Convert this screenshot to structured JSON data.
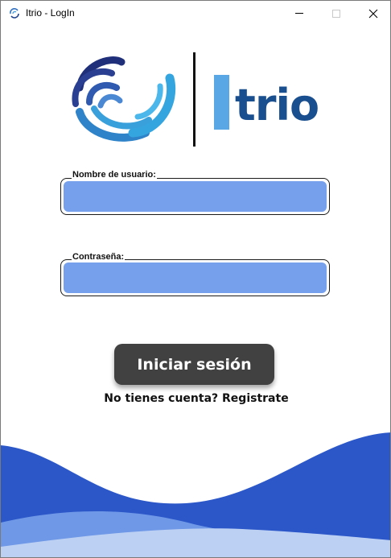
{
  "window": {
    "title": "Itrio - LogIn",
    "controls": [
      "minimize",
      "maximize",
      "close"
    ]
  },
  "logo": {
    "brand_text": "trio",
    "icon": "swirl-logo-icon"
  },
  "form": {
    "username": {
      "label": "Nombre de usuario:",
      "value": "",
      "placeholder": ""
    },
    "password": {
      "label": "Contraseña:",
      "value": "",
      "placeholder": ""
    },
    "login_label": "Iniciar sesión",
    "register_label": "No tienes cuenta? Registrate"
  },
  "colors": {
    "input_fill": "#76a0ec",
    "button_bg": "#414141",
    "brand_dark": "#1a4f8f",
    "brand_light": "#5aa7e6",
    "wave_dark": "#2b57c9",
    "wave_mid": "#6f98e6",
    "wave_light": "#bcd0f4"
  }
}
